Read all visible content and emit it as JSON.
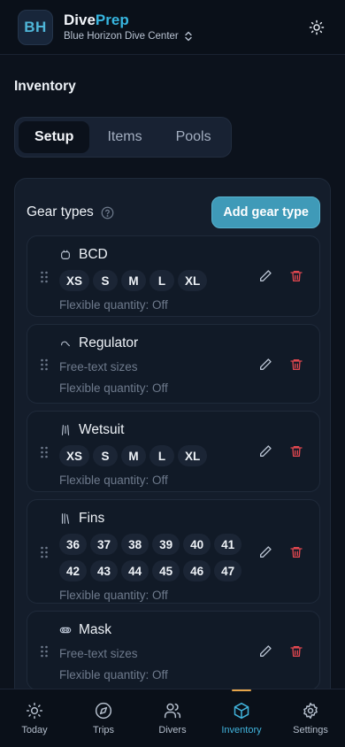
{
  "header": {
    "logo_initials": "BH",
    "brand_main": "Dive",
    "brand_accent": "Prep",
    "center_name": "Blue Horizon Dive Center",
    "theme_icon": "sun-icon"
  },
  "page": {
    "title": "Inventory"
  },
  "tabs": [
    {
      "label": "Setup",
      "active": true
    },
    {
      "label": "Items",
      "active": false
    },
    {
      "label": "Pools",
      "active": false
    }
  ],
  "gear_section": {
    "title": "Gear types",
    "add_button": "Add gear type",
    "items": [
      {
        "name": "BCD",
        "icon": "bcd-icon",
        "sizes": [
          "XS",
          "S",
          "M",
          "L",
          "XL"
        ],
        "free_text": "",
        "flex": "Flexible quantity: Off"
      },
      {
        "name": "Regulator",
        "icon": "regulator-icon",
        "sizes": [],
        "free_text": "Free-text sizes",
        "flex": "Flexible quantity: Off"
      },
      {
        "name": "Wetsuit",
        "icon": "wetsuit-icon",
        "sizes": [
          "XS",
          "S",
          "M",
          "L",
          "XL"
        ],
        "free_text": "",
        "flex": "Flexible quantity: Off"
      },
      {
        "name": "Fins",
        "icon": "fins-icon",
        "sizes": [
          "36",
          "37",
          "38",
          "39",
          "40",
          "41",
          "42",
          "43",
          "44",
          "45",
          "46",
          "47"
        ],
        "free_text": "",
        "flex": "Flexible quantity: Off"
      },
      {
        "name": "Mask",
        "icon": "mask-icon",
        "sizes": [],
        "free_text": "Free-text sizes",
        "flex": "Flexible quantity: Off"
      }
    ]
  },
  "nav": [
    {
      "label": "Today",
      "icon": "sun-icon",
      "active": false
    },
    {
      "label": "Trips",
      "icon": "compass-icon",
      "active": false
    },
    {
      "label": "Divers",
      "icon": "users-icon",
      "active": false
    },
    {
      "label": "Inventory",
      "icon": "box-icon",
      "active": true
    },
    {
      "label": "Settings",
      "icon": "gear-icon",
      "active": false
    }
  ],
  "colors": {
    "accent": "#37b6e0",
    "danger": "#e0474f",
    "active_indicator": "#e6a54a"
  }
}
